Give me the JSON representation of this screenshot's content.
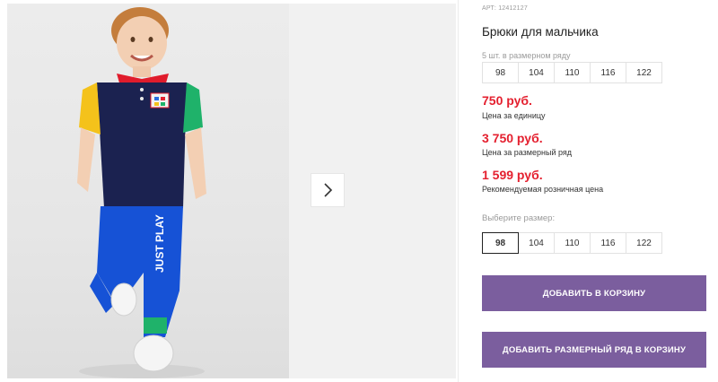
{
  "product": {
    "sku": "АРТ: 12412127",
    "title": "Брюки для мальчика",
    "pack_note": "5 шт. в размерном ряду",
    "pack_sizes": [
      "98",
      "104",
      "110",
      "116",
      "122"
    ]
  },
  "prices": {
    "unit_price": "750 руб.",
    "unit_label": "Цена за единицу",
    "pack_price": "3 750 руб.",
    "pack_label": "Цена за размерный ряд",
    "retail_price": "1 599 руб.",
    "retail_label": "Рекомендуемая розничная цена"
  },
  "size_picker": {
    "label": "Выберите размер:",
    "options": [
      "98",
      "104",
      "110",
      "116",
      "122"
    ],
    "selected": "98"
  },
  "actions": {
    "add_to_cart": "ДОБАВИТЬ В КОРЗИНУ",
    "add_pack_to_cart": "ДОБАВИТЬ РАЗМЕРНЫЙ РЯД В КОРЗИНУ"
  },
  "photo_print_text": "JUST PLAY",
  "colors": {
    "price": "#e4202f",
    "button": "#7b5e9e"
  },
  "icons": {
    "next": "chevron-right-icon"
  }
}
